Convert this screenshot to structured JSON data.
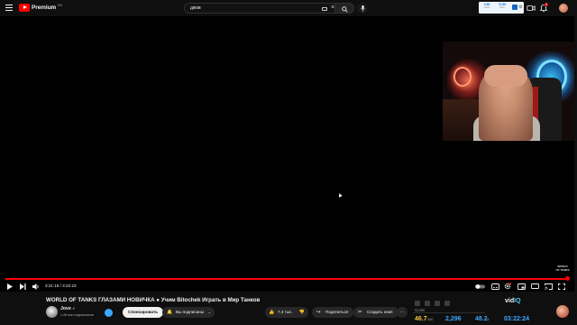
{
  "header": {
    "logo_text": "Premium",
    "logo_sup": "RU",
    "search_value": "джов",
    "notifications_count": "9",
    "extension": {
      "cell1_value": "2.66",
      "cell1_label": "Views",
      "cell2_value": "73.80",
      "cell2_label": "Subs"
    }
  },
  "player": {
    "time_current": "3:21:16",
    "time_total": "3:22:23",
    "progress_fraction": 0.995,
    "watermark_text": "WORLD OF TANKS"
  },
  "video": {
    "title": "WORLD OF TANKS ГЛАЗАМИ НОВИЧКА ● Учим Bitochek Играть в Мир Танков",
    "channel_name": "Jove",
    "channel_subs": "1,46 млн подписчиков",
    "sponsor_label": "Спонсировать",
    "subscribed_label": "Вы подписаны",
    "likes": "7,4 тыс.",
    "share_label": "Поделиться",
    "clip_label": "Создать клип"
  },
  "vidiq": {
    "logo_main": "vid",
    "logo_accent": "IQ",
    "score_label": "SCORE",
    "score_value": "46.7",
    "score_suffix": "/100",
    "views_value": "2,296",
    "vph_value": "48.2",
    "vph_suffix": "k",
    "duration_value": "03:22:24"
  },
  "colors": {
    "accent_red": "#ff0000",
    "score_yellow": "#f6c344",
    "stat_blue": "#3ea6ff"
  }
}
